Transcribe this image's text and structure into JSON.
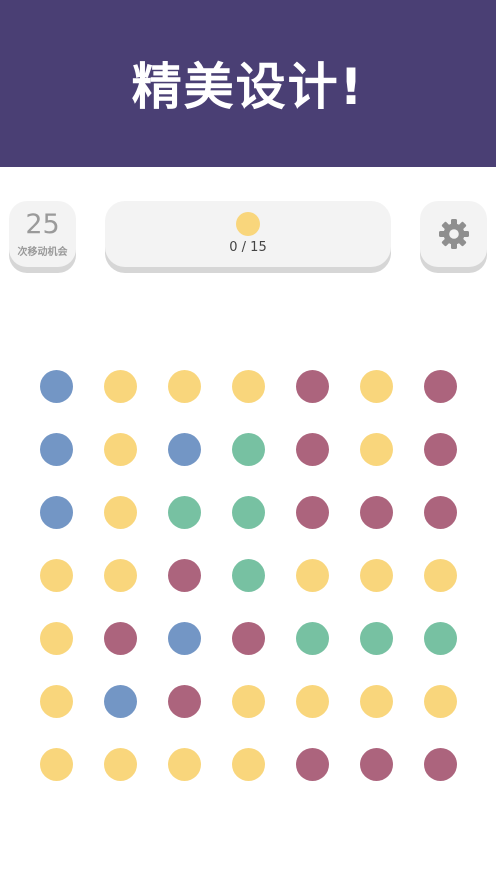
{
  "banner": {
    "title": "精美设计!"
  },
  "moves": {
    "count": "25",
    "label": "次移动机会"
  },
  "goal": {
    "progress": "0 / 15",
    "dot_color": "yellow"
  },
  "settings": {
    "icon": "gear-icon"
  },
  "colors": {
    "yellow": "#f9d67c",
    "blue": "#7396c5",
    "green": "#77c1a2",
    "purple": "#ac647d",
    "banner": "#4a3f74"
  },
  "board": {
    "rows": [
      [
        "blue",
        "yellow",
        "yellow",
        "yellow",
        "purple",
        "yellow",
        "purple"
      ],
      [
        "blue",
        "yellow",
        "blue",
        "green",
        "purple",
        "yellow",
        "purple"
      ],
      [
        "blue",
        "yellow",
        "green",
        "green",
        "purple",
        "purple",
        "purple"
      ],
      [
        "yellow",
        "yellow",
        "purple",
        "green",
        "yellow",
        "yellow",
        "yellow"
      ],
      [
        "yellow",
        "purple",
        "blue",
        "purple",
        "green",
        "green",
        "green"
      ],
      [
        "yellow",
        "blue",
        "purple",
        "yellow",
        "yellow",
        "yellow",
        "yellow"
      ],
      [
        "yellow",
        "yellow",
        "yellow",
        "yellow",
        "purple",
        "purple",
        "purple"
      ]
    ]
  }
}
